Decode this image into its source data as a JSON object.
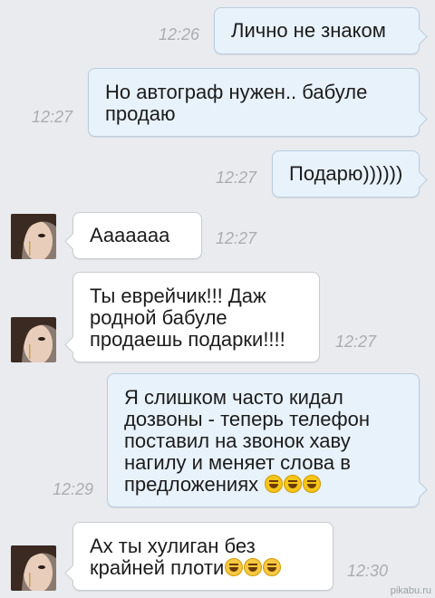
{
  "messages": [
    {
      "text": "Лично не знаком",
      "time": "12:26"
    },
    {
      "text": "Но автограф нужен.. бабуле продаю",
      "time": "12:27"
    },
    {
      "text": "Подарю))))))",
      "time": "12:27"
    },
    {
      "text": "Ааааааа",
      "time": "12:27"
    },
    {
      "text": "Ты еврейчик!!! Даж родной бабуле продаешь подарки!!!!",
      "time": "12:27"
    },
    {
      "text": "Я слишком часто кидал дозвоны - теперь телефон поставил на звонок хаву нагилу и меняет слова в предложениях",
      "time": "12:29",
      "emoji": "laughing-emoji"
    },
    {
      "text": "Ах ты хулиган без крайней плоти",
      "time": "12:30",
      "emoji": "tears-of-joy-emoji"
    }
  ],
  "watermark": "pikabu.ru",
  "colors": {
    "outgoing_bubble": "#e8f2fb",
    "incoming_bubble": "#ffffff",
    "background": "#e9ebee",
    "time": "#a9adb2"
  }
}
